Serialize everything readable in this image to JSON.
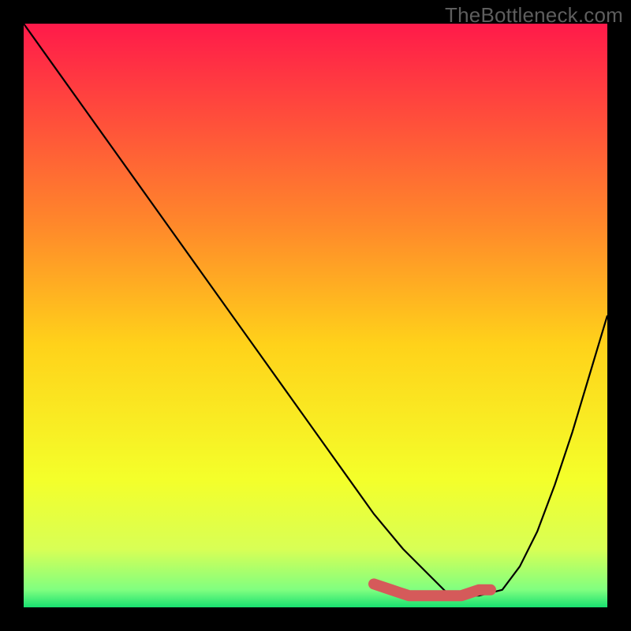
{
  "watermark": "TheBottleneck.com",
  "chart_data": {
    "type": "line",
    "title": "",
    "xlabel": "",
    "ylabel": "",
    "xlim": [
      0,
      100
    ],
    "ylim": [
      0,
      100
    ],
    "background_gradient": {
      "stops": [
        {
          "offset": 0.0,
          "color": "#ff1a4a"
        },
        {
          "offset": 0.35,
          "color": "#ff8a2a"
        },
        {
          "offset": 0.55,
          "color": "#ffd21a"
        },
        {
          "offset": 0.78,
          "color": "#f4ff2a"
        },
        {
          "offset": 0.9,
          "color": "#d8ff55"
        },
        {
          "offset": 0.97,
          "color": "#80ff80"
        },
        {
          "offset": 1.0,
          "color": "#18e070"
        }
      ]
    },
    "series": [
      {
        "name": "bottleneck-curve",
        "color": "#000000",
        "x": [
          0,
          5,
          10,
          15,
          20,
          25,
          30,
          35,
          40,
          45,
          50,
          55,
          60,
          65,
          70,
          73,
          78,
          82,
          85,
          88,
          91,
          94,
          97,
          100
        ],
        "y": [
          100,
          93,
          86,
          79,
          72,
          65,
          58,
          51,
          44,
          37,
          30,
          23,
          16,
          10,
          5,
          2,
          2,
          3,
          7,
          13,
          21,
          30,
          40,
          50
        ]
      }
    ],
    "highlight": {
      "name": "optimal-band",
      "color": "#d55a5a",
      "x": [
        60,
        63,
        66,
        69,
        72,
        75,
        78,
        80
      ],
      "y": [
        4,
        3,
        2,
        2,
        2,
        2,
        3,
        3
      ]
    }
  }
}
